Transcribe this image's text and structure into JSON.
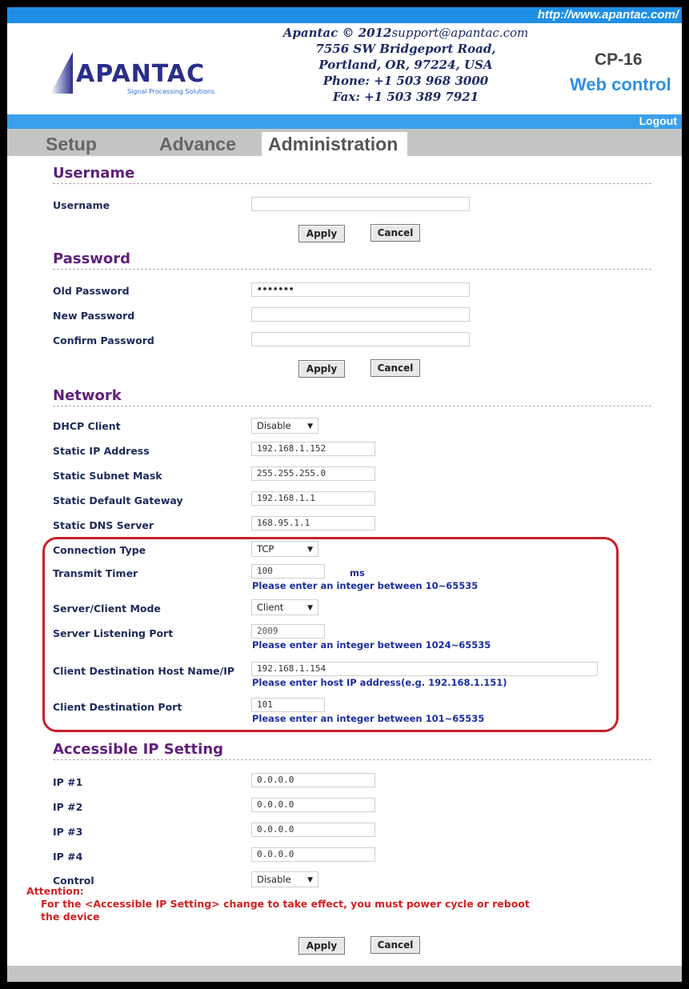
{
  "header": {
    "url": "http://www.apantac.com/",
    "company_line1_a": "Apantac © 2012",
    "company_line1_b": "support@apantac.com",
    "address1": "7556 SW Bridgeport Road,",
    "address2": "Portland, OR, 97224, USA",
    "phone": "Phone: +1 503 968 3000",
    "fax": "Fax: +1 503 389 7921",
    "model": "CP-16",
    "web_control": "Web control",
    "logo_text": "APANTAC",
    "logo_tagline": "Signal Processing Solutions",
    "logout": "Logout"
  },
  "tabs": {
    "setup": "Setup",
    "advance": "Advance",
    "administration": "Administration",
    "active": "administration"
  },
  "username": {
    "title": "Username",
    "label": "Username",
    "value": "",
    "apply": "Apply",
    "cancel": "Cancel"
  },
  "password": {
    "title": "Password",
    "old_label": "Old Password",
    "old_value": "•••••••",
    "new_label": "New Password",
    "new_value": "",
    "confirm_label": "Confirm Password",
    "confirm_value": "",
    "apply": "Apply",
    "cancel": "Cancel"
  },
  "network": {
    "title": "Network",
    "dhcp_label": "DHCP Client",
    "dhcp_value": "Disable",
    "ip_label": "Static IP Address",
    "ip_value": "192.168.1.152",
    "mask_label": "Static Subnet Mask",
    "mask_value": "255.255.255.0",
    "gateway_label": "Static Default Gateway",
    "gateway_value": "192.168.1.1",
    "dns_label": "Static DNS Server",
    "dns_value": "168.95.1.1",
    "conn_label": "Connection Type",
    "conn_value": "TCP",
    "timer_label": "Transmit Timer",
    "timer_value": "100",
    "timer_unit": "ms",
    "timer_hint": "Please enter an integer between 10~65535",
    "mode_label": "Server/Client Mode",
    "mode_value": "Client",
    "port_label": "Server Listening Port",
    "port_value": "2009",
    "port_hint": "Please enter an integer between 1024~65535",
    "host_label": "Client Destination Host Name/IP",
    "host_value": "192.168.1.154",
    "host_hint": "Please enter host IP address(e.g. 192.168.1.151)",
    "dest_port_label": "Client Destination Port",
    "dest_port_value": "101",
    "dest_port_hint": "Please enter an integer between 101~65535",
    "highlight_color": "#c8202a"
  },
  "accessible": {
    "title": "Accessible IP Setting",
    "ip1_label": "IP #1",
    "ip1_value": "0.0.0.0",
    "ip2_label": "IP #2",
    "ip2_value": "0.0.0.0",
    "ip3_label": "IP #3",
    "ip3_value": "0.0.0.0",
    "ip4_label": "IP #4",
    "ip4_value": "0.0.0.0",
    "control_label": "Control",
    "control_value": "Disable",
    "attention_title": "Attention:",
    "attention_line1": "For the <Accessible IP Setting> change to take effect, you must power cycle or reboot",
    "attention_line2": "the device",
    "apply": "Apply",
    "cancel": "Cancel"
  },
  "colors": {
    "top_bar": "#1f8fe5",
    "section_title": "#60207a",
    "hint_text": "#1a2ea0",
    "attention": "#d42020"
  }
}
